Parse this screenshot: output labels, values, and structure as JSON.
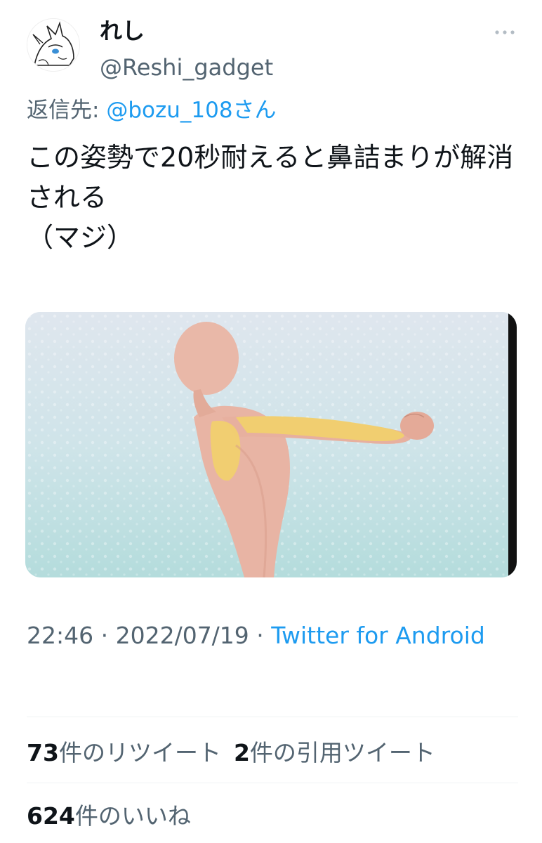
{
  "author": {
    "display_name": "れし",
    "handle": "@Reshi_gadget"
  },
  "reply": {
    "prefix": "返信先: ",
    "mention": "@bozu_108さん"
  },
  "tweet": {
    "text": "この姿勢で20秒耐えると鼻詰まりが解消される\n（マジ）"
  },
  "meta": {
    "time": "22:46",
    "separator": " · ",
    "date": "2022/07/19",
    "source": "Twitter for Android"
  },
  "stats": {
    "retweets_count": "73",
    "retweets_label": "件のリツイート",
    "quotes_count": "2",
    "quotes_label": "件の引用ツイート",
    "likes_count": "624",
    "likes_label": "件のいいね"
  },
  "colors": {
    "link": "#1d9bf0",
    "secondary_text": "#536471",
    "primary_text": "#0f1419"
  },
  "icons": {
    "more": "more-horizontal-icon"
  }
}
